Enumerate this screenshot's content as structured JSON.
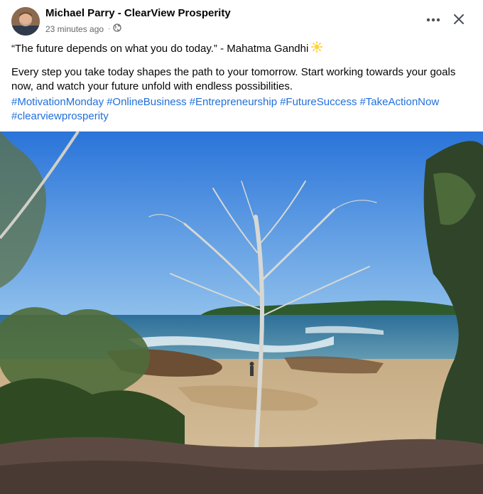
{
  "post": {
    "author": "Michael Parry - ClearView Prosperity",
    "timestamp": "23 minutes ago",
    "privacy_icon": "globe-icon",
    "quote": "“The future depends on what you do today.” - Mahatma Gandhi",
    "quote_emoji": "sun-emoji",
    "message": "Every step you take today shapes the path to your tomorrow. Start working towards your goals now, and watch your future unfold with endless possibilities.",
    "hashtags": [
      "#MotivationMonday",
      "#OnlineBusiness",
      "#Entrepreneurship",
      "#FutureSuccess",
      "#TakeActionNow",
      "#clearviewprosperity"
    ]
  },
  "colors": {
    "link": "#216fdb",
    "meta": "#65676b",
    "sky": "#2f7de0",
    "ocean": "#3f7fa8",
    "sand": "#c9ad84"
  }
}
